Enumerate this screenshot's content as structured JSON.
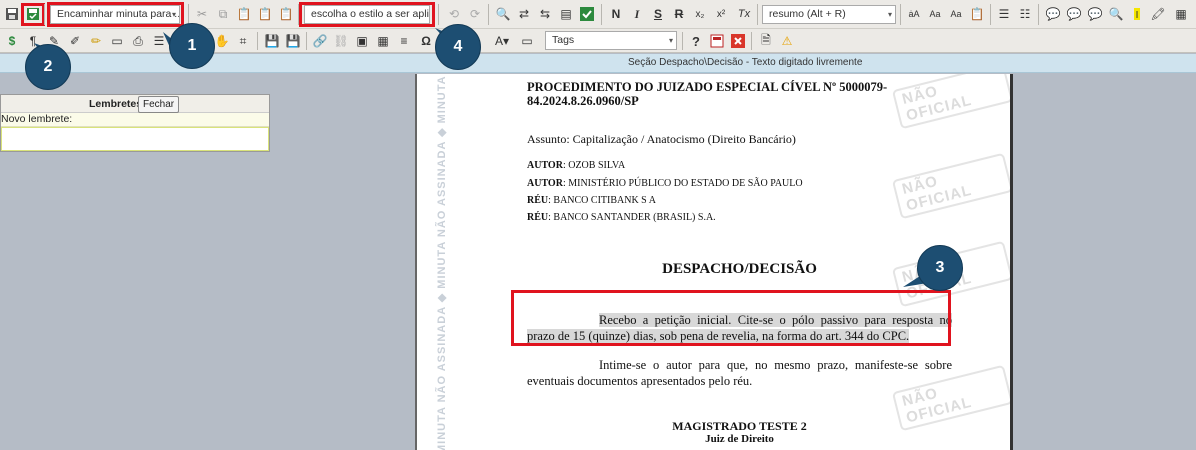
{
  "toolbar1": {
    "forward_combo": "Encaminhar minuta para ...",
    "style_combo": "escolha o estilo a ser apli...",
    "summary_combo": "resumo (Alt + R)",
    "format_buttons": [
      "N",
      "I",
      "S",
      "R",
      "x₂",
      "x²",
      "Tx"
    ]
  },
  "toolbar2": {
    "tags_combo": "Tags",
    "help_label": "?"
  },
  "info_bar": {
    "text": "Seção Despacho\\Decisão - Texto digitado livremente"
  },
  "reminders": {
    "title": "Lembretes",
    "close_label": "Fechar",
    "new_label": "Novo lembrete:"
  },
  "document": {
    "watermark_vertical": "MINUTA NÃO ASSINADA ◆ MINUTA NÃO ASSINADA ◆ MINUTA NÃO ASSINADA",
    "stamp_text": "NÃO OFICIAL",
    "procedure_line1": "PROCEDIMENTO DO JUIZADO ESPECIAL CÍVEL Nº 5000079-",
    "procedure_line2": "84.2024.8.26.0960/SP",
    "subject": "Assunto: Capitalização / Anatocismo (Direito Bancário)",
    "parties": [
      {
        "role": "AUTOR",
        "name": ": OZOB SILVA"
      },
      {
        "role": "AUTOR",
        "name": ": MINISTÉRIO PÚBLICO DO ESTADO DE SÃO PAULO"
      },
      {
        "role": "RÉU",
        "name": ": BANCO CITIBANK S A"
      },
      {
        "role": "RÉU",
        "name": ": BANCO SANTANDER (BRASIL) S.A."
      }
    ],
    "heading": "DESPACHO/DECISÃO",
    "paragraph1_l1": "Recebo a petição inicial. Cite-se o pólo passivo para resposta no",
    "paragraph1_l2": "prazo de 15 (quinze) dias, sob pena de revelia, na forma do art. 344 do CPC.",
    "paragraph2_l1": "Intime-se o autor para que, no mesmo prazo, manifeste-se sobre",
    "paragraph2_l2": "eventuais documentos apresentados pelo réu.",
    "signer_name": "MAGISTRADO TESTE 2",
    "signer_title": "Juiz de Direito"
  },
  "callouts": [
    "1",
    "2",
    "3",
    "4"
  ],
  "colors": {
    "highlight": "#e0131e",
    "callout": "#1d4e72",
    "toolbar": "#eceae6",
    "workspace": "#b5bcc6",
    "info_bar": "#cfe3ee"
  }
}
